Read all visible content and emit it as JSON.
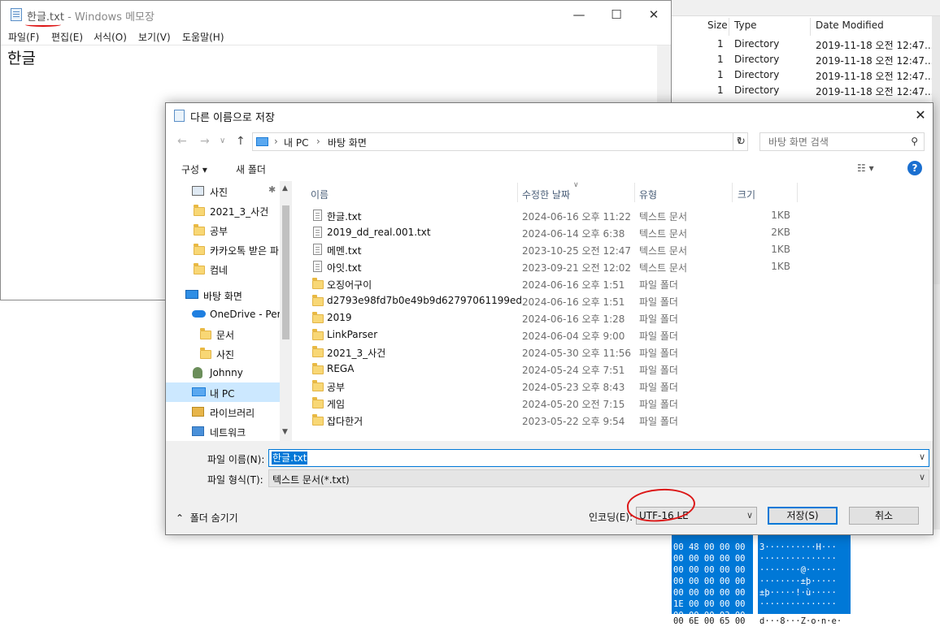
{
  "bg_explorer": {
    "headers": [
      "Size",
      "Type",
      "Date Modified"
    ],
    "rows": [
      {
        "size": "1",
        "type": "Directory",
        "date": "2019-11-18 오전 12:47..."
      },
      {
        "size": "1",
        "type": "Directory",
        "date": "2019-11-18 오전 12:47..."
      },
      {
        "size": "1",
        "type": "Directory",
        "date": "2019-11-18 오전 12:47..."
      },
      {
        "size": "1",
        "type": "Directory",
        "date": "2019-11-18 오전 12:47..."
      }
    ],
    "hex_lines": [
      "00 48 00 00 00",
      "00 00 00 00 00",
      "00 00 00 00 00",
      "00 00 00 00 00",
      "00 00 00 00 00",
      "1E 00 00 00 00",
      "00 00 00 03 00",
      "00 6E 00 65 00"
    ],
    "ascii_lines": [
      "3··········H···",
      "···············",
      "········@······",
      "········±þ·····",
      "±þ·····!·ù·····",
      "···············",
      "d···8···Z·o·n·e·"
    ]
  },
  "notepad": {
    "file_name": "한글.txt",
    "title_suffix": " - Windows 메모장",
    "menu": [
      "파일(F)",
      "편집(E)",
      "서식(O)",
      "보기(V)",
      "도움말(H)"
    ],
    "content": "한글"
  },
  "dialog": {
    "title": "다른 이름으로 저장",
    "breadcrumb": [
      "내 PC",
      "바탕 화면"
    ],
    "search_placeholder": "바탕 화면 검색",
    "toolbar": {
      "organize": "구성 ▾",
      "new_folder": "새 폴더"
    },
    "tree": [
      {
        "label": "사진",
        "icon": "picture-icon"
      },
      {
        "label": "2021_3_사건",
        "icon": "folder-icon"
      },
      {
        "label": "공부",
        "icon": "folder-icon"
      },
      {
        "label": "카카오톡 받은 파",
        "icon": "folder-icon"
      },
      {
        "label": "컴네",
        "icon": "folder-icon"
      },
      {
        "label": "바탕 화면",
        "icon": "desktop-icon"
      },
      {
        "label": "OneDrive - Pers",
        "icon": "cloud-icon"
      },
      {
        "label": "문서",
        "icon": "folder-icon"
      },
      {
        "label": "사진",
        "icon": "folder-icon"
      },
      {
        "label": "Johnny",
        "icon": "user-icon"
      },
      {
        "label": "내 PC",
        "icon": "pc-icon"
      },
      {
        "label": "라이브러리",
        "icon": "library-icon"
      },
      {
        "label": "네트워크",
        "icon": "network-icon"
      }
    ],
    "columns": [
      "이름",
      "수정한 날짜",
      "유형",
      "크기"
    ],
    "files": [
      {
        "name": "한글.txt",
        "date": "2024-06-16 오후 11:22",
        "type": "텍스트 문서",
        "size": "1KB",
        "kind": "doc"
      },
      {
        "name": "2019_dd_real.001.txt",
        "date": "2024-06-14 오후 6:38",
        "type": "텍스트 문서",
        "size": "2KB",
        "kind": "doc"
      },
      {
        "name": "메멘.txt",
        "date": "2023-10-25 오전 12:47",
        "type": "텍스트 문서",
        "size": "1KB",
        "kind": "doc"
      },
      {
        "name": "아잇.txt",
        "date": "2023-09-21 오전 12:02",
        "type": "텍스트 문서",
        "size": "1KB",
        "kind": "doc"
      },
      {
        "name": "오징어구이",
        "date": "2024-06-16 오후 1:51",
        "type": "파일 폴더",
        "size": "",
        "kind": "folder"
      },
      {
        "name": "d2793e98fd7b0e49b9d62797061199ed",
        "date": "2024-06-16 오후 1:51",
        "type": "파일 폴더",
        "size": "",
        "kind": "folder"
      },
      {
        "name": "2019",
        "date": "2024-06-16 오후 1:28",
        "type": "파일 폴더",
        "size": "",
        "kind": "folder"
      },
      {
        "name": "LinkParser",
        "date": "2024-06-04 오후 9:00",
        "type": "파일 폴더",
        "size": "",
        "kind": "folder"
      },
      {
        "name": "2021_3_사건",
        "date": "2024-05-30 오후 11:56",
        "type": "파일 폴더",
        "size": "",
        "kind": "folder"
      },
      {
        "name": "REGA",
        "date": "2024-05-24 오후 7:51",
        "type": "파일 폴더",
        "size": "",
        "kind": "folder"
      },
      {
        "name": "공부",
        "date": "2024-05-23 오후 8:43",
        "type": "파일 폴더",
        "size": "",
        "kind": "folder"
      },
      {
        "name": "게임",
        "date": "2024-05-20 오전 7:15",
        "type": "파일 폴더",
        "size": "",
        "kind": "folder"
      },
      {
        "name": "잡다한거",
        "date": "2023-05-22 오후 9:54",
        "type": "파일 폴더",
        "size": "",
        "kind": "folder"
      }
    ],
    "filename_label": "파일 이름(N):",
    "filename_value": "한글.txt",
    "filetype_label": "파일 형식(T):",
    "filetype_value": "텍스트 문서(*.txt)",
    "hide_folders": "폴더 숨기기",
    "encoding_label": "인코딩(E):",
    "encoding_value": "UTF-16 LE",
    "save_button": "저장(S)",
    "cancel_button": "취소"
  }
}
